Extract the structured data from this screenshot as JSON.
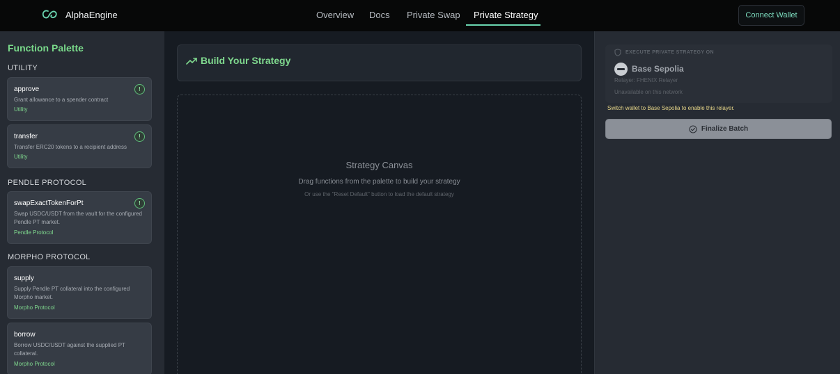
{
  "header": {
    "brand_name": "AlphaEngine",
    "nav": [
      {
        "label": "Overview"
      },
      {
        "label": "Docs"
      },
      {
        "label": "Private Swap"
      },
      {
        "label": "Private Strategy",
        "active": true
      }
    ],
    "connect_label": "Connect Wallet"
  },
  "sidebar": {
    "title": "Function Palette",
    "sections": [
      {
        "label": "UTILITY"
      },
      {
        "label": "PENDLE PROTOCOL"
      },
      {
        "label": "MORPHO PROTOCOL"
      }
    ],
    "functions": [
      {
        "name": "approve",
        "desc": "Grant allowance to a spender contract",
        "tag": "Utility"
      },
      {
        "name": "transfer",
        "desc": "Transfer ERC20 tokens to a recipient address",
        "tag": "Utility"
      },
      {
        "name": "swapExactTokenForPt",
        "desc": "Swap USDC/USDT from the vault for the configured Pendle PT market.",
        "tag": "Pendle Protocol"
      },
      {
        "name": "supply",
        "desc": "Supply Pendle PT collateral into the configured Morpho market.",
        "tag": "Morpho Protocol"
      },
      {
        "name": "borrow",
        "desc": "Borrow USDC/USDT against the supplied PT collateral.",
        "tag": "Morpho Protocol"
      }
    ],
    "info_glyph": "!"
  },
  "main": {
    "title": "Build Your Strategy",
    "canvas_title": "Strategy Canvas",
    "canvas_sub": "Drag functions from the palette to build your strategy",
    "canvas_hint": "Or use the \"Reset Default\" button to load the default strategy"
  },
  "right": {
    "exec_label": "EXECUTE PRIVATE STRATEGY ON",
    "network_name": "Base Sepolia",
    "relayer": "Relayer: FHENIX Relayer",
    "unavailable": "Unavailable on this network",
    "warning": "Switch wallet to Base Sepolia to enable this relayer.",
    "finalize_label": "Finalize Batch"
  },
  "colors": {
    "accent_green": "#79d98a",
    "nav_underline": "#6ad6b1",
    "warning_yellow": "#e9d88a"
  }
}
